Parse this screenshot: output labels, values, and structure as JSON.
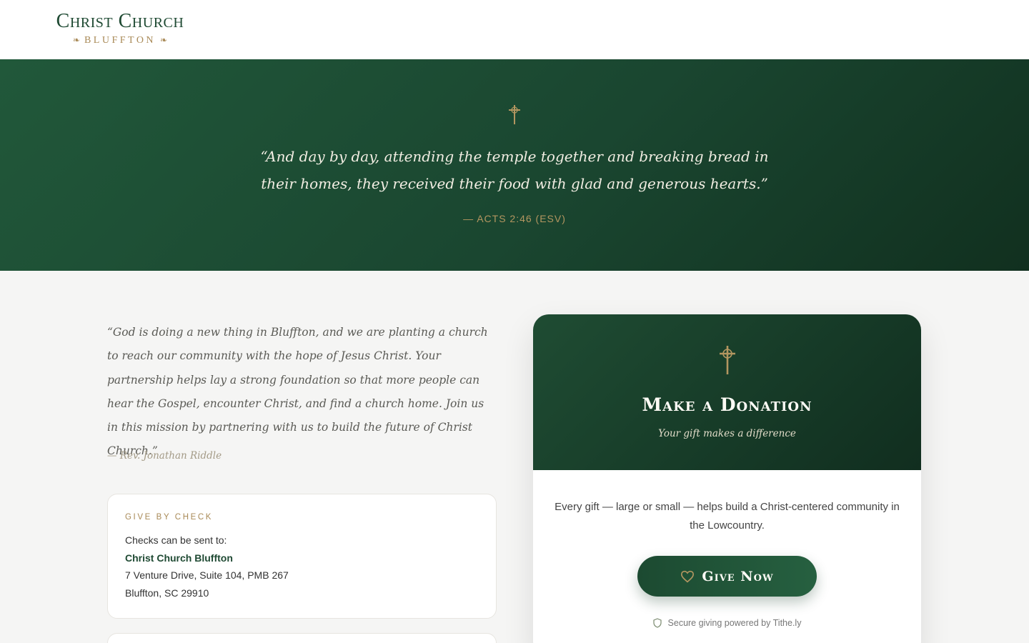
{
  "header": {
    "logo_title": "Christ Church",
    "logo_subtitle": "BLUFFTON",
    "ornament_left": "❧",
    "ornament_right": "❧"
  },
  "hero": {
    "icon": "cross-icon",
    "quote": "“And day by day, attending the temple together and breaking bread in their homes, they received their food with glad and generous hearts.”",
    "reference": "— ACTS 2:46 (ESV)"
  },
  "pastor": {
    "quote": "“God is doing a new thing in Bluffton, and we are planting a church to reach our community with the hope of Jesus Christ. Your partnership helps lay a strong foundation so that more people can hear the Gospel, encounter Christ, and find a church home. Join us in this mission by partnering with us to build the future of Christ Church.”",
    "attribution": "— Rev. Jonathan Riddle"
  },
  "check": {
    "heading": "GIVE BY CHECK",
    "intro": "Checks can be sent to:",
    "org": "Christ Church Bluffton",
    "address1": "7 Venture Drive, Suite 104, PMB 267",
    "address2": "Bluffton, SC 29910"
  },
  "donate": {
    "icon": "cross-icon",
    "title": "Make a Donation",
    "subtitle": "Your gift makes a difference",
    "body": "Every gift — large or small — helps build a Christ-centered community in the Lowcountry.",
    "button_label": "Give Now",
    "button_icon": "heart-icon",
    "secure_icon": "shield-icon",
    "secure_text": "Secure giving powered by Tithe.ly"
  },
  "colors": {
    "brand_green": "#1f4a33",
    "hero_green": "#1a4630",
    "accent_gold": "#a98a57",
    "background": "#f5f5f4"
  }
}
